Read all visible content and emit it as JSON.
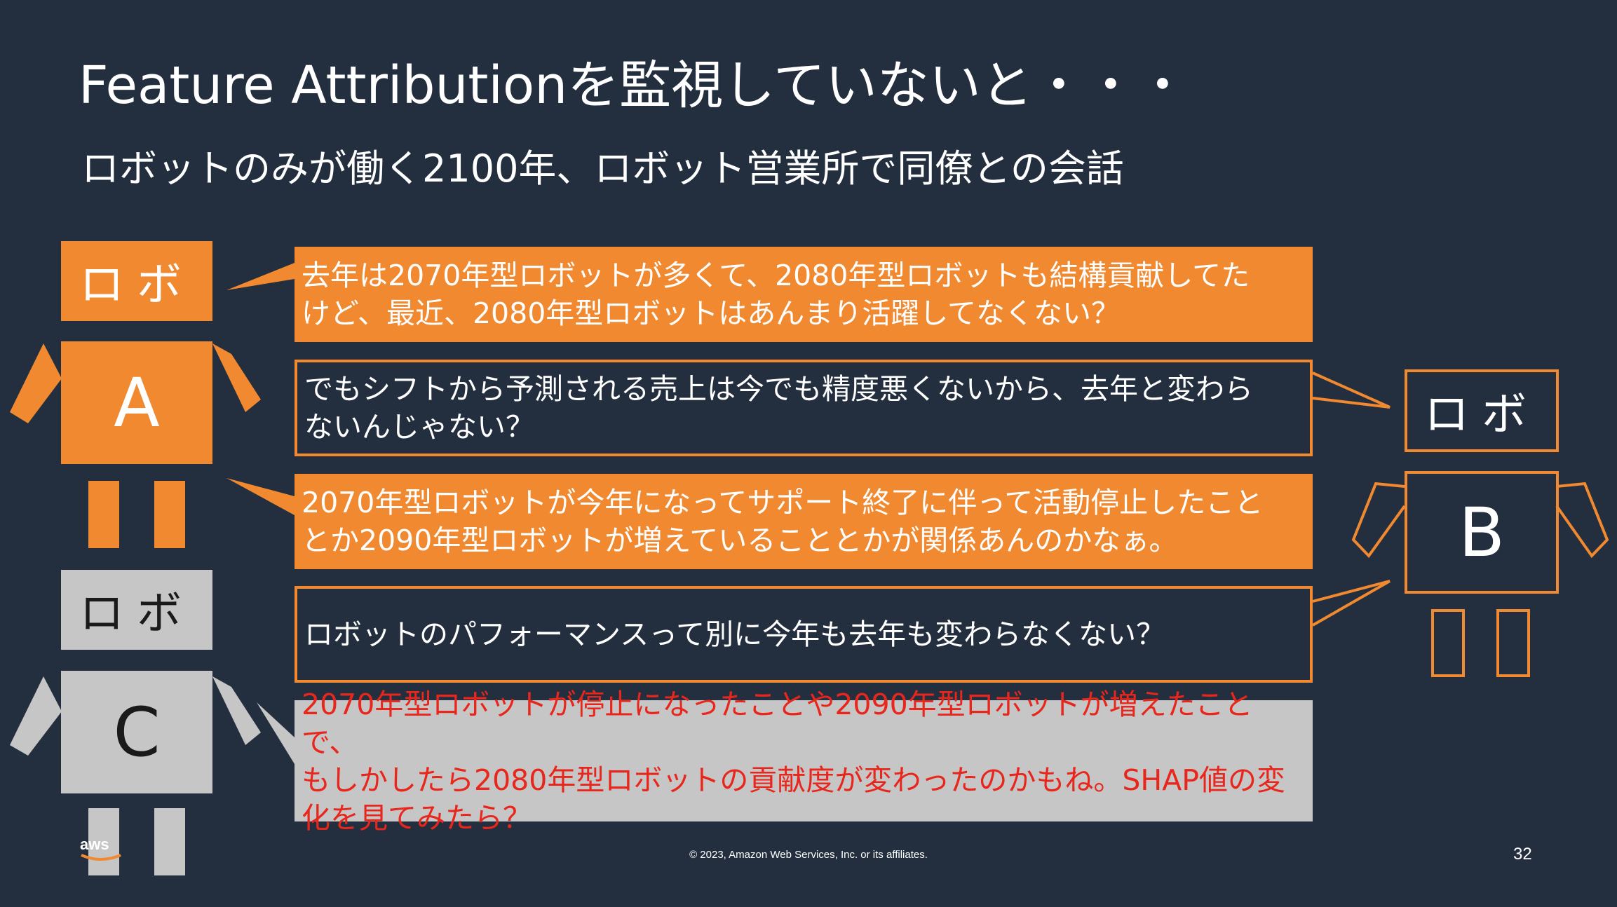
{
  "slide": {
    "title": "Feature Attributionを監視していないと・・・",
    "subtitle": "ロボットのみが働く2100年、ロボット営業所で同僚との会話",
    "footer_copyright": "© 2023, Amazon Web Services, Inc. or its affiliates.",
    "page_number": "32"
  },
  "robots": {
    "a": {
      "head_label": "ロボ",
      "body_label": "A",
      "color": "#f0892f"
    },
    "b": {
      "head_label": "ロボ",
      "body_label": "B",
      "color": "#f0892f"
    },
    "c": {
      "head_label": "ロボ",
      "body_label": "C",
      "color": "#c6c6c6"
    }
  },
  "dialogue": [
    {
      "speaker": "A",
      "lines": [
        "去年は2070年型ロボットが多くて、2080年型ロボットも結構貢献してた",
        "けど、最近、2080年型ロボットはあんまり活躍してなくない？"
      ]
    },
    {
      "speaker": "B",
      "lines": [
        "でもシフトから予測される売上は今でも精度悪くないから、去年と変わら",
        "ないんじゃない？"
      ]
    },
    {
      "speaker": "A",
      "lines": [
        "2070年型ロボットが今年になってサポート終了に伴って活動停止したこと",
        "とか2090年型ロボットが増えていることとかが関係あんのかなぁ。"
      ]
    },
    {
      "speaker": "B",
      "lines": [
        "ロボットのパフォーマンスって別に今年も去年も変わらなくない？"
      ]
    },
    {
      "speaker": "C",
      "lines": [
        "2070年型ロボットが停止になったことや2090年型ロボットが増えたことで、",
        "もしかしたら2080年型ロボットの貢献度が変わったのかもね。SHAP値の変",
        "化を見てみたら？"
      ]
    }
  ],
  "colors": {
    "background": "#232f3e",
    "accent_orange": "#f0892f",
    "robot_gray": "#c6c6c6",
    "highlight_red": "#e8261c",
    "text_white": "#ffffff"
  },
  "icons": {
    "aws_logo": "aws-logo-icon"
  }
}
